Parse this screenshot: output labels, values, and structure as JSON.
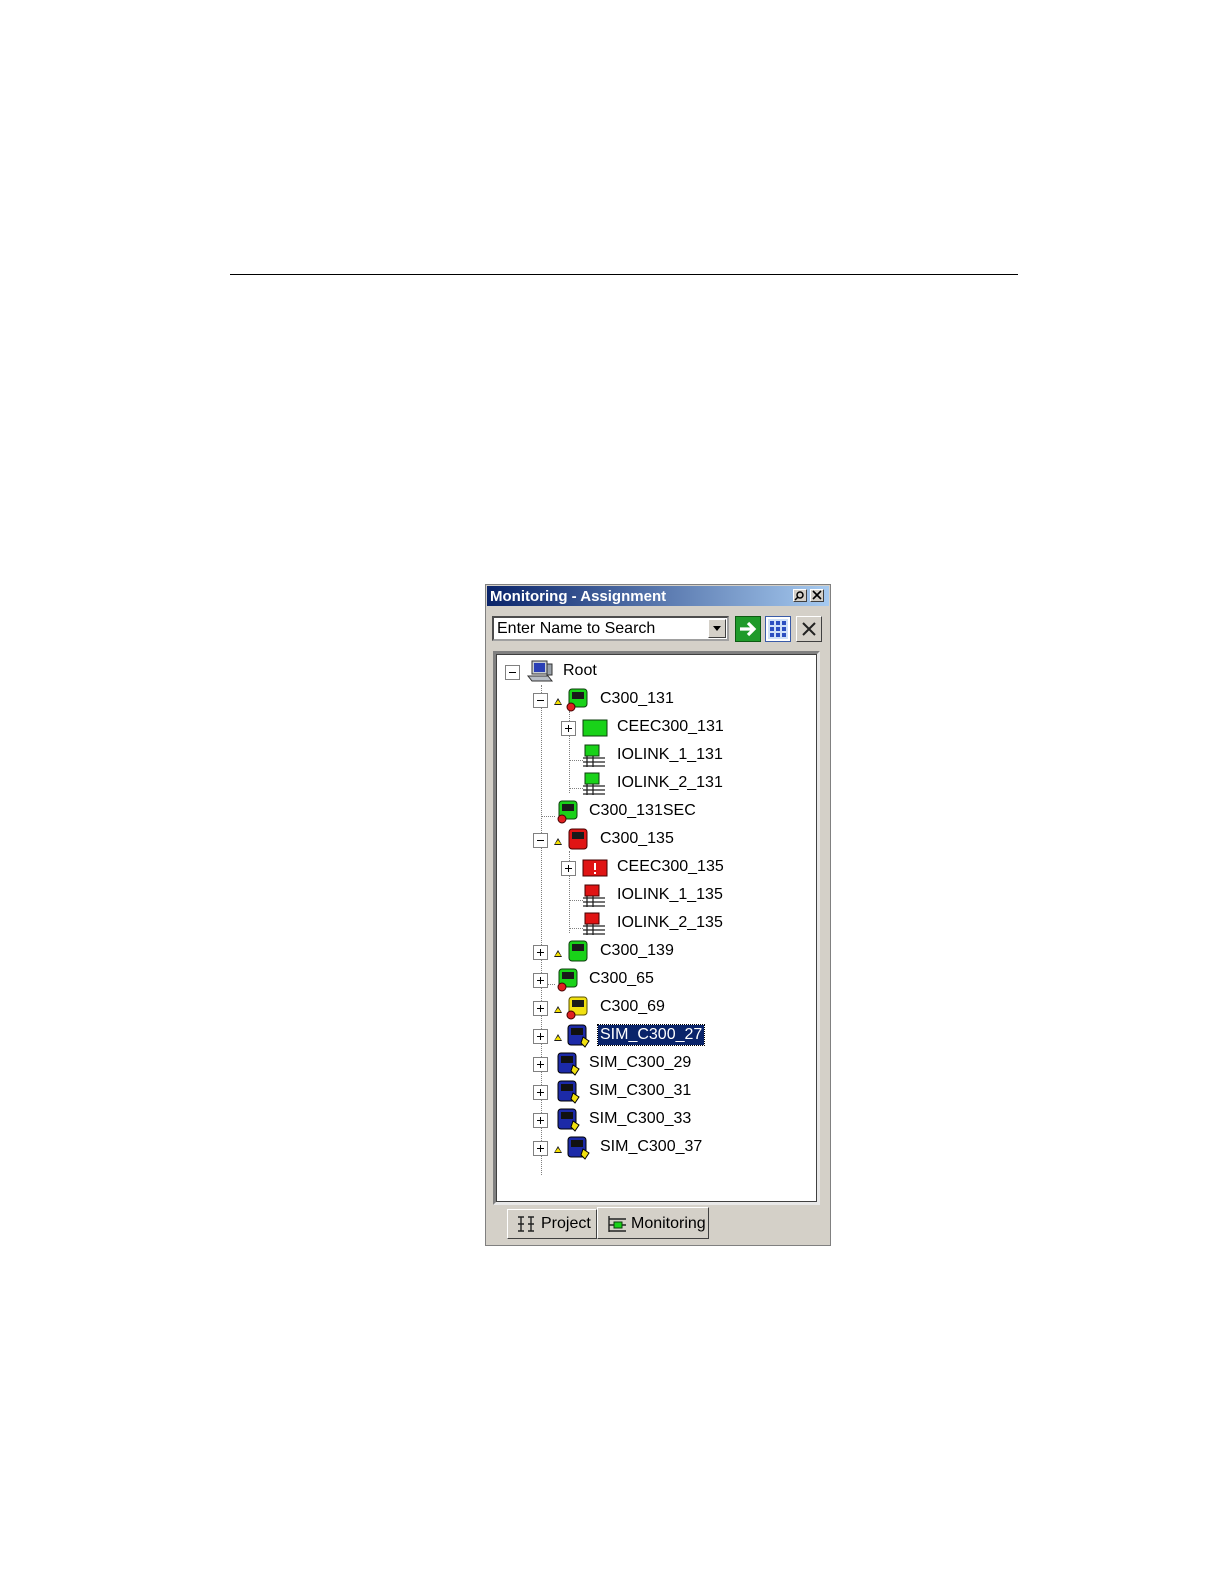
{
  "window": {
    "title": "Monitoring - Assignment",
    "pin_icon": "pin-icon",
    "close_icon": "close-icon"
  },
  "search": {
    "value": "Enter Name to Search"
  },
  "toolbar": {
    "go_icon": "arrow-right-icon",
    "grid_icon": "grid-icon",
    "clear_icon": "x-icon"
  },
  "tree": {
    "root": "Root",
    "items": [
      {
        "label": "C300_131",
        "status": "green"
      },
      {
        "label": "CEEC300_131",
        "status": "green"
      },
      {
        "label": "IOLINK_1_131",
        "status": "green"
      },
      {
        "label": "IOLINK_2_131",
        "status": "green"
      },
      {
        "label": "C300_131SEC",
        "status": "green"
      },
      {
        "label": "C300_135",
        "status": "red"
      },
      {
        "label": "CEEC300_135",
        "status": "red"
      },
      {
        "label": "IOLINK_1_135",
        "status": "red"
      },
      {
        "label": "IOLINK_2_135",
        "status": "red"
      },
      {
        "label": "C300_139",
        "status": "green"
      },
      {
        "label": "C300_65",
        "status": "green"
      },
      {
        "label": "C300_69",
        "status": "yellow"
      },
      {
        "label": "SIM_C300_27",
        "status": "blue"
      },
      {
        "label": "SIM_C300_29",
        "status": "blue"
      },
      {
        "label": "SIM_C300_31",
        "status": "blue"
      },
      {
        "label": "SIM_C300_33",
        "status": "blue"
      },
      {
        "label": "SIM_C300_37",
        "status": "blue"
      }
    ]
  },
  "tabs": [
    {
      "label": "Project"
    },
    {
      "label": "Monitoring"
    }
  ],
  "colors": {
    "title_bar": "#0a246a",
    "selection": "#0a246a",
    "green": "#19d219",
    "red": "#e01414",
    "yellow": "#f0e010",
    "blue": "#1c2aa8"
  }
}
